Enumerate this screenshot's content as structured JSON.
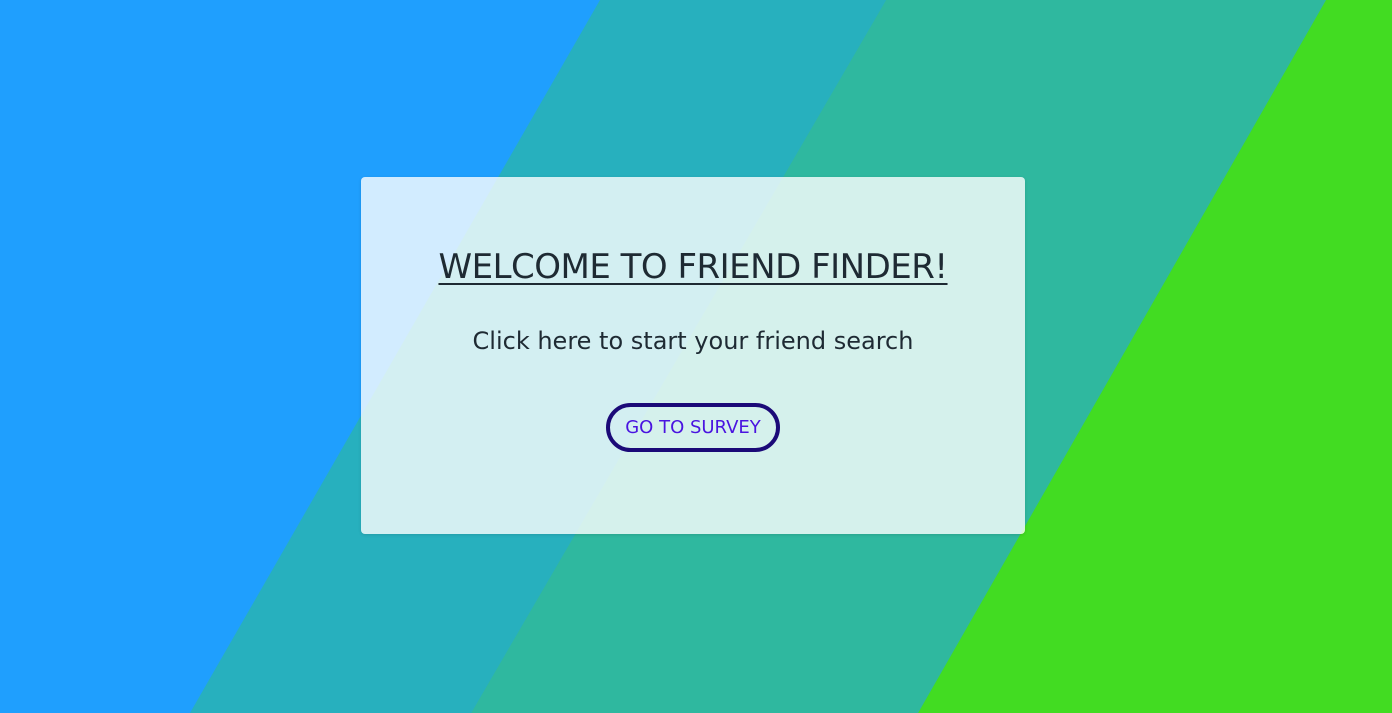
{
  "background": {
    "colors": [
      "#1f9ffe",
      "#27b0be",
      "#2fb89f",
      "#42dc22"
    ]
  },
  "card": {
    "title": "WELCOME TO FRIEND FINDER!",
    "subtitle": "Click here to start your friend search",
    "button_label": "GO TO SURVEY"
  },
  "colors": {
    "text": "#1e2a33",
    "button_border": "#1b0a78",
    "button_text": "#4a14e0"
  }
}
